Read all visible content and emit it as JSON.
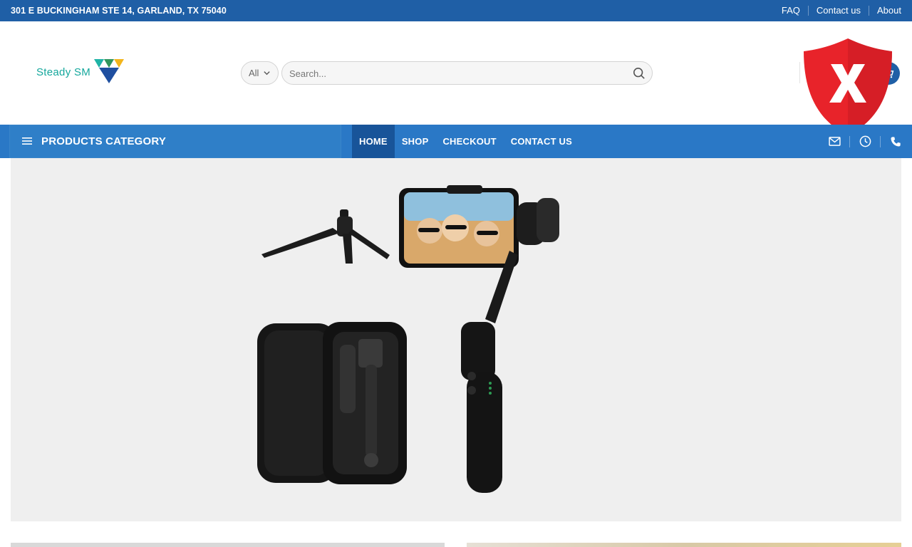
{
  "topbar": {
    "address": "301 E BUCKINGHAM STE 14, GARLAND, TX 75040",
    "links": [
      {
        "label": "FAQ"
      },
      {
        "label": "Contact us"
      },
      {
        "label": "About"
      }
    ]
  },
  "header": {
    "logo_text": "Steady SM",
    "category_select": {
      "selected": "All"
    },
    "search": {
      "placeholder": "Search..."
    }
  },
  "nav": {
    "categories_label": "PRODUCTS CATEGORY",
    "items": [
      {
        "label": "HOME",
        "active": true
      },
      {
        "label": "SHOP",
        "active": false
      },
      {
        "label": "CHECKOUT",
        "active": false
      },
      {
        "label": "CONTACT US",
        "active": false
      }
    ],
    "icons": [
      "mail-icon",
      "clock-icon",
      "phone-icon"
    ]
  },
  "shield_overlay": {
    "letter": "X"
  },
  "colors": {
    "topbar": "#1f5fa6",
    "navbar": "#2a78c6",
    "nav_active": "#185499",
    "logo_teal": "#14a79c",
    "shield_red": "#e8232a"
  }
}
